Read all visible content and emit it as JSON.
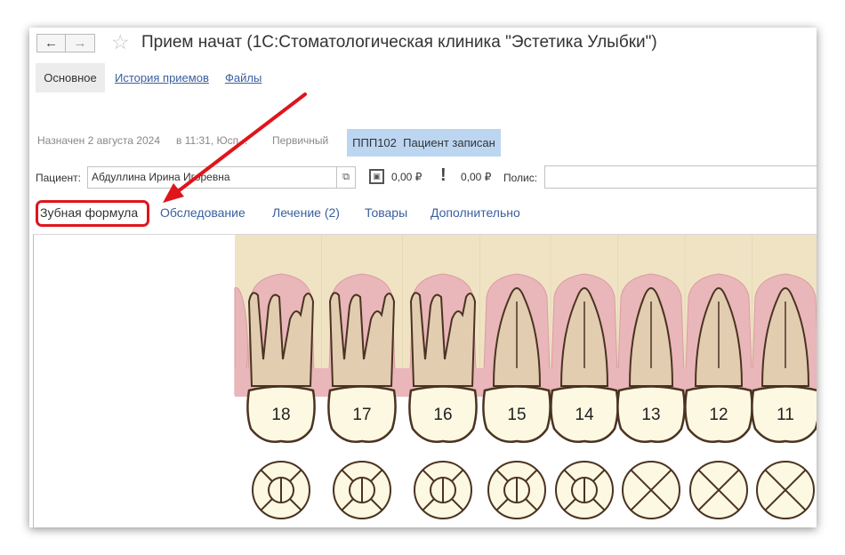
{
  "window": {
    "title": "Прием начат (1С:Стоматологическая клиника \"Эстетика Улыбки\")",
    "back_icon": "←",
    "forward_icon": "→",
    "star_icon": "☆"
  },
  "sections": [
    {
      "label": "Основное",
      "active": true
    },
    {
      "label": "История приемов",
      "active": false
    },
    {
      "label": "Файлы",
      "active": false
    }
  ],
  "appointment": {
    "assigned": "Назначен 2 августа 2024",
    "time": "в 11:31, Юсп...",
    "type": "Первичный",
    "status_code": "ППП102",
    "status": "Пациент записан"
  },
  "patient": {
    "label": "Пациент:",
    "name": "Абдуллина Ирина Игоревна",
    "open_icon": "⧉",
    "amount1": "0,00 ₽",
    "amount2": "0,00 ₽",
    "polis_label": "Полис:",
    "polis_value": ""
  },
  "tabs": [
    {
      "label": "Зубная формула",
      "active": true
    },
    {
      "label": "Обследование",
      "active": false
    },
    {
      "label": "Лечение (2)",
      "active": false
    },
    {
      "label": "Товары",
      "active": false
    },
    {
      "label": "Дополнительно",
      "active": false
    }
  ],
  "teeth": [
    {
      "number": "18",
      "type": "molar",
      "status": "pie"
    },
    {
      "number": "17",
      "type": "molar",
      "status": "pie"
    },
    {
      "number": "16",
      "type": "molar",
      "status": "pie"
    },
    {
      "number": "15",
      "type": "premolar",
      "status": "pie"
    },
    {
      "number": "14",
      "type": "premolar",
      "status": "pie"
    },
    {
      "number": "13",
      "type": "canine",
      "status": "cross"
    },
    {
      "number": "12",
      "type": "incisor",
      "status": "cross"
    },
    {
      "number": "11",
      "type": "incisor",
      "status": "cross"
    }
  ],
  "colors": {
    "accent_link": "#3a5f9e",
    "badge_bg": "#bcd6f2",
    "highlight": "#e0141b",
    "gum": "#e9b6b9",
    "formula_bg": "#efe3c4",
    "tooth_root": "#e3cdb1",
    "tooth_crown": "#fdf8e1"
  }
}
